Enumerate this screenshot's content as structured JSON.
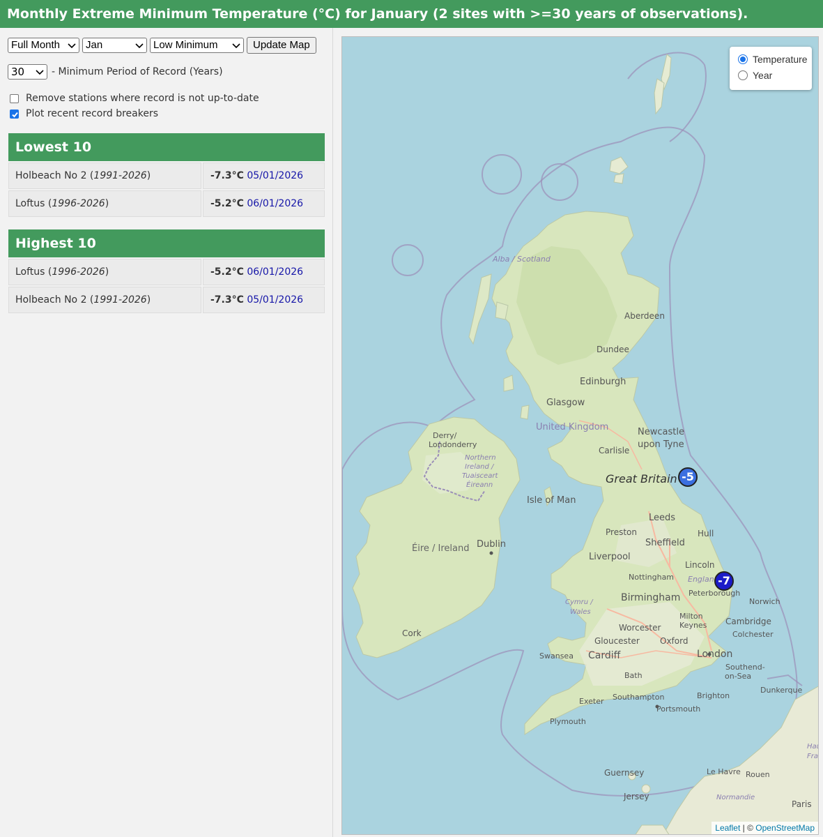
{
  "header": {
    "title": "Monthly Extreme Minimum Temperature (°C) for January (2 sites with >=30 years of observations)."
  },
  "controls": {
    "period": "Full Month",
    "month": "Jan",
    "measure": "Low Minimum",
    "update_label": "Update Map",
    "min_years": "30",
    "min_years_label": "- Minimum Period of Record (Years)",
    "remove_outdated_label": "Remove stations where record is not up-to-date",
    "plot_breakers_label": "Plot recent record breakers"
  },
  "lowest": {
    "heading": "Lowest 10",
    "rows": [
      {
        "name": "Holbeach No 2",
        "years": "1991-2026",
        "temp": "-7.3°C",
        "date": "05/01/2026"
      },
      {
        "name": "Loftus",
        "years": "1996-2026",
        "temp": "-5.2°C",
        "date": "06/01/2026"
      }
    ]
  },
  "highest": {
    "heading": "Highest 10",
    "rows": [
      {
        "name": "Loftus",
        "years": "1996-2026",
        "temp": "-5.2°C",
        "date": "06/01/2026"
      },
      {
        "name": "Holbeach No 2",
        "years": "1991-2026",
        "temp": "-7.3°C",
        "date": "05/01/2026"
      }
    ]
  },
  "map": {
    "legend": {
      "option1": "Temperature",
      "option2": "Year",
      "selected": "Temperature"
    },
    "attribution": {
      "leaflet": "Leaflet",
      "sep": " | © ",
      "osm": "OpenStreetMap"
    },
    "labels": {
      "alba": "Alba / Scotland",
      "aberdeen": "Aberdeen",
      "dundee": "Dundee",
      "edinburgh": "Edinburgh",
      "glasgow": "Glasgow",
      "uk": "United Kingdom",
      "newcastle1": "Newcastle",
      "newcastle2": "upon Tyne",
      "carlisle": "Carlisle",
      "gb": "Great Britain",
      "derry1": "Derry/",
      "derry2": "Londonderry",
      "ni1": "Northern",
      "ni2": "Ireland /",
      "ni3": "Tuaisceart",
      "ni4": "Éireann",
      "iom": "Isle of Man",
      "leeds": "Leeds",
      "preston": "Preston",
      "hull": "Hull",
      "sheffield": "Sheffield",
      "liverpool": "Liverpool",
      "eire": "Éire / Ireland",
      "dublin": "Dublin",
      "lincoln": "Lincoln",
      "nottingham": "Nottingham",
      "england": "England",
      "peterborough": "Peterborough",
      "norwich": "Norwich",
      "birmingham": "Birmingham",
      "wales1": "Cymru /",
      "wales2": "Wales",
      "milton1": "Milton",
      "milton2": "Keynes",
      "cambridge": "Cambridge",
      "colchester": "Colchester",
      "worcester": "Worcester",
      "gloucester": "Gloucester",
      "oxford": "Oxford",
      "cork": "Cork",
      "swansea": "Swansea",
      "cardiff": "Cardiff",
      "london": "London",
      "southend1": "Southend-",
      "southend2": "on-Sea",
      "bath": "Bath",
      "dunkerque": "Dunkerque",
      "exeter": "Exeter",
      "southampton": "Southampton",
      "brighton": "Brighton",
      "portsmouth": "Portsmouth",
      "plymouth": "Plymouth",
      "guernsey": "Guernsey",
      "jersey": "Jersey",
      "lehavre": "Le Havre",
      "rouen": "Rouen",
      "normandie": "Normandie",
      "paris": "Paris",
      "hau1": "Hau",
      "hau2": "Fra"
    },
    "markers": [
      {
        "label": "-5",
        "color": "#3b6fe0"
      },
      {
        "label": "-7",
        "color": "#1b1bc8"
      }
    ]
  }
}
